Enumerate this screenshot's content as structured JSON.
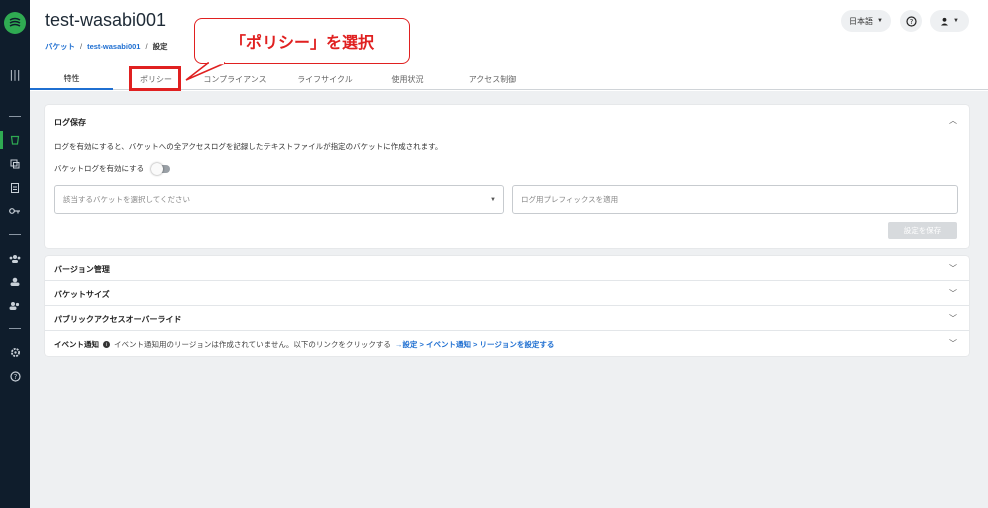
{
  "header": {
    "title": "test-wasabi001",
    "breadcrumb": [
      "バケット",
      "test-wasabi001",
      "設定"
    ],
    "language": "日本語",
    "help_icon": "help-circle-icon",
    "user_icon": "user-icon"
  },
  "tabs": [
    "特性",
    "ポリシー",
    "コンプライアンス",
    "ライフサイクル",
    "使用状況",
    "アクセス制御"
  ],
  "callout": {
    "text": "「ポリシー」を選択"
  },
  "log_section": {
    "title": "ログ保存",
    "description": "ログを有効にすると、バケットへの全アクセスログを記録したテキストファイルが指定のバケットに作成されます。",
    "toggle_label": "バケットログを有効にする",
    "toggle_on": false,
    "bucket_select_placeholder": "該当するバケットを選択してください",
    "prefix_placeholder": "ログ用プレフィックスを適用",
    "save_label": "設定を保存"
  },
  "sections": [
    "バージョン管理",
    "バケットサイズ",
    "パブリックアクセスオーバーライド"
  ],
  "event": {
    "title": "イベント通知",
    "message": "イベント通知用のリージョンは作成されていません。以下のリンクをクリックする",
    "link": "→設定 > イベント通知 > リージョンを設定する"
  },
  "colors": {
    "accent": "#1f6fd1",
    "brand": "#2faa52",
    "callout": "#e02020",
    "sidebar": "#0f1d2c"
  }
}
